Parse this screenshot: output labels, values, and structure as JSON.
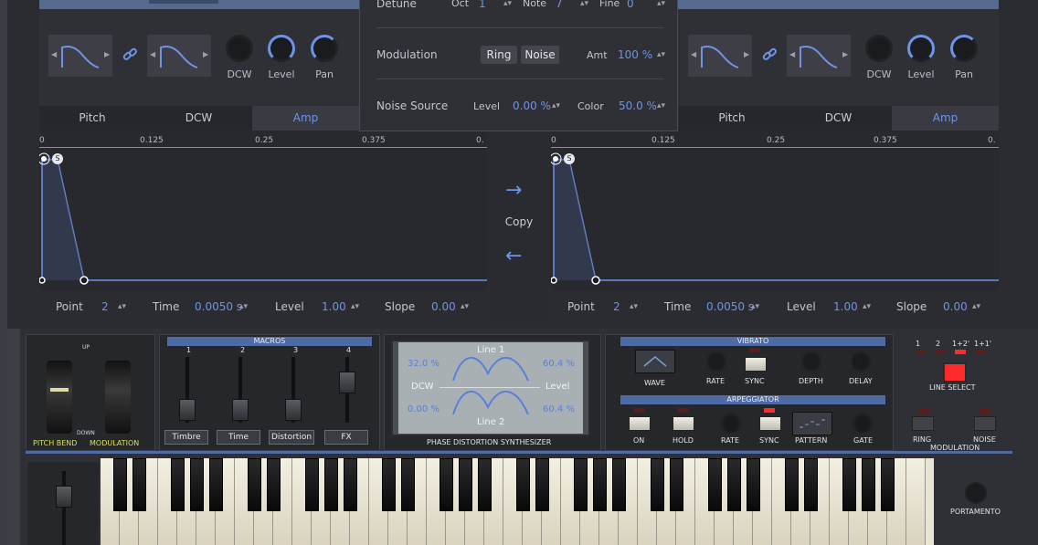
{
  "colors": {
    "accent": "#6f93e6",
    "panel": "#2c2d33",
    "section_title": "#4f6ba3",
    "led_on": "#ff2a2a"
  },
  "left_panel": {
    "knobs": [
      {
        "label": "DCW"
      },
      {
        "label": "Level"
      },
      {
        "label": "Pan"
      }
    ],
    "tabs": [
      {
        "label": "Pitch"
      },
      {
        "label": "DCW"
      },
      {
        "label": "Amp"
      }
    ],
    "active_tab": "Amp",
    "ruler": [
      "0",
      "0.125",
      "0.25",
      "0.375",
      "0."
    ],
    "controls": {
      "point_label": "Point",
      "point_value": "2",
      "time_label": "Time",
      "time_value": "0.0050 s",
      "level_label": "Level",
      "level_value": "1.00",
      "slope_label": "Slope",
      "slope_value": "0.00"
    },
    "sustain_marker": "S"
  },
  "right_panel": {
    "knobs": [
      {
        "label": "DCW"
      },
      {
        "label": "Level"
      },
      {
        "label": "Pan"
      }
    ],
    "tabs": [
      {
        "label": "Pitch"
      },
      {
        "label": "DCW"
      },
      {
        "label": "Amp"
      }
    ],
    "active_tab": "Amp",
    "ruler": [
      "0",
      "0.125",
      "0.25",
      "0.375",
      "0."
    ],
    "controls": {
      "point_label": "Point",
      "point_value": "2",
      "time_label": "Time",
      "time_value": "0.0050 s",
      "level_label": "Level",
      "level_value": "1.00",
      "slope_label": "Slope",
      "slope_value": "0.00"
    },
    "sustain_marker": "S"
  },
  "overlay": {
    "detune": {
      "label": "Detune",
      "oct_label": "Oct",
      "oct_value": "1",
      "note_label": "Note",
      "note_value": "7",
      "fine_label": "Fine",
      "fine_value": "0"
    },
    "modulation": {
      "label": "Modulation",
      "ring": "Ring",
      "noise": "Noise",
      "amt_label": "Amt",
      "amt_value": "100 %"
    },
    "noise_source": {
      "label": "Noise Source",
      "level_label": "Level",
      "level_value": "0.00 %",
      "color_label": "Color",
      "color_value": "50.0 %"
    }
  },
  "copy": {
    "label": "Copy",
    "right_arrow": "→",
    "left_arrow": "←"
  },
  "synth": {
    "pitch_bend": "PITCH BEND",
    "modulation": "MODULATION",
    "up": "UP",
    "down": "DOWN",
    "macros": {
      "title": "MACROS",
      "numbers": [
        "1",
        "2",
        "3",
        "4"
      ],
      "buttons": [
        "Timbre",
        "Time",
        "Distortion",
        "FX"
      ]
    },
    "lcd": {
      "line1": "Line 1",
      "line2": "Line 2",
      "dcw": "DCW",
      "level": "Level",
      "tl": "32.0 %",
      "tr": "60.4 %",
      "bl": "0.00 %",
      "br": "60.4 %",
      "caption": "PHASE DISTORTION SYNTHESIZER"
    },
    "vibrato": {
      "title": "VIBRATO",
      "wave": "WAVE",
      "rate": "RATE",
      "sync": "SYNC",
      "depth": "DEPTH",
      "delay": "DELAY"
    },
    "arpeggiator": {
      "title": "ARPEGGIATOR",
      "on": "ON",
      "hold": "HOLD",
      "rate": "RATE",
      "sync": "SYNC",
      "pattern": "PATTERN",
      "gate": "GATE"
    },
    "line_select": {
      "options": [
        "1",
        "2",
        "1+2'",
        "1+1'"
      ],
      "label": "LINE SELECT"
    },
    "modulation_section": {
      "ring": "RING",
      "noise": "NOISE",
      "label": "MODULATION"
    },
    "portamento": "PORTAMENTO"
  }
}
